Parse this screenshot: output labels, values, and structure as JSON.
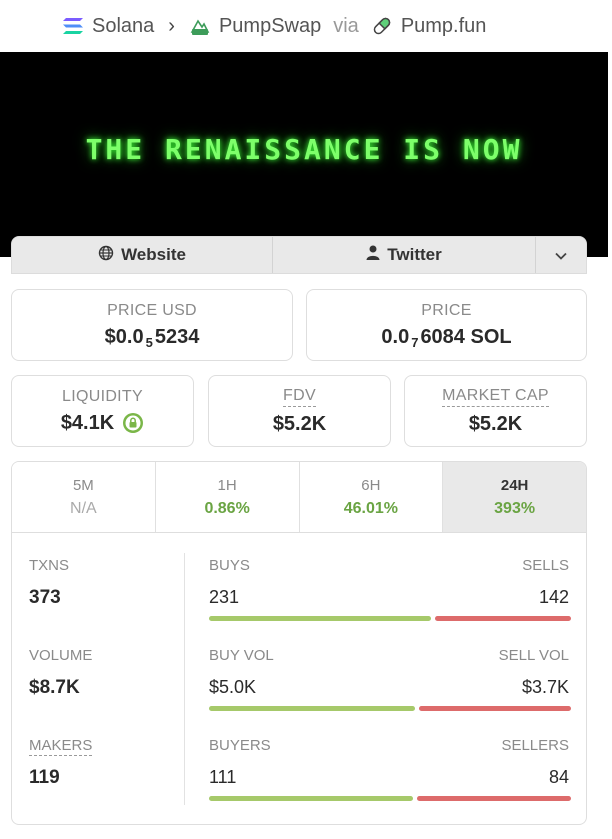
{
  "breadcrumb": {
    "chain": "Solana",
    "dex": "PumpSwap",
    "via": "via",
    "launchpad": "Pump.fun"
  },
  "banner": {
    "text": "THE RENAISSANCE IS NOW"
  },
  "links": {
    "website": "Website",
    "twitter": "Twitter"
  },
  "price_usd": {
    "label": "PRICE USD",
    "prefix": "$0.0",
    "zeros": "5",
    "digits": "5234"
  },
  "price_native": {
    "label": "PRICE",
    "prefix": "0.0",
    "zeros": "7",
    "digits": "6084 SOL"
  },
  "liquidity": {
    "label": "LIQUIDITY",
    "value": "$4.1K"
  },
  "fdv": {
    "label": "FDV",
    "value": "$5.2K"
  },
  "market_cap": {
    "label": "MARKET CAP",
    "value": "$5.2K"
  },
  "tabs": [
    {
      "label": "5M",
      "value": "N/A"
    },
    {
      "label": "1H",
      "value": "0.86%"
    },
    {
      "label": "6H",
      "value": "46.01%"
    },
    {
      "label": "24H",
      "value": "393%"
    }
  ],
  "stats": {
    "txns": {
      "label": "TXNS",
      "value": "373"
    },
    "volume": {
      "label": "VOLUME",
      "value": "$8.7K"
    },
    "makers": {
      "label": "MAKERS",
      "value": "119"
    },
    "buys": {
      "label": "BUYS",
      "value": "231",
      "share": 0.619
    },
    "sells": {
      "label": "SELLS",
      "value": "142"
    },
    "buy_vol": {
      "label": "BUY VOL",
      "value": "$5.0K",
      "share": 0.575
    },
    "sell_vol": {
      "label": "SELL VOL",
      "value": "$3.7K"
    },
    "buyers": {
      "label": "BUYERS",
      "value": "111",
      "share": 0.569
    },
    "sellers": {
      "label": "SELLERS",
      "value": "84"
    }
  },
  "colors": {
    "positive": "#6aa443",
    "buy_bar": "#a6c96a",
    "sell_bar": "#dd6b6b",
    "banner_text": "#7dff6a"
  }
}
